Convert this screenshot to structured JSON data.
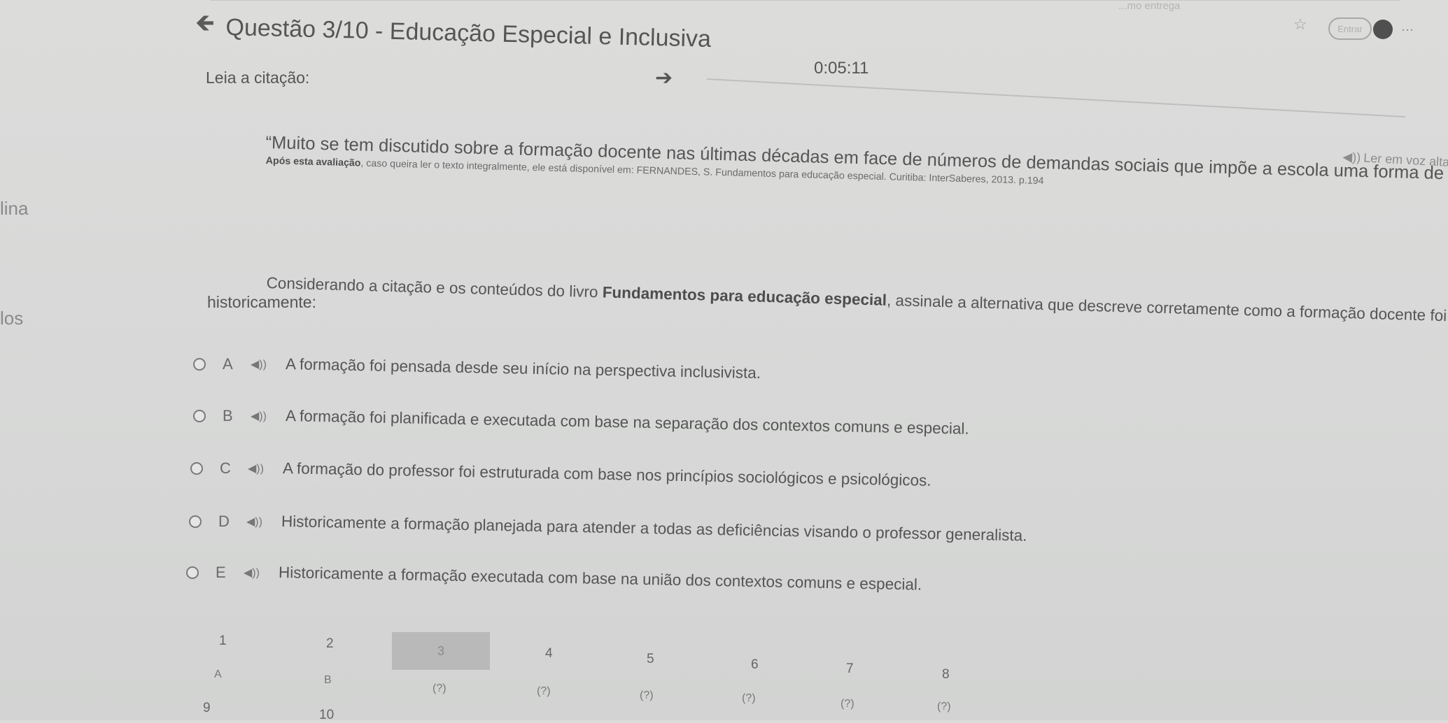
{
  "header": {
    "title": "Questão 3/10 - Educação Especial e Inclusiva",
    "timer": "0:05:11",
    "back_icon": "arrow-left-icon",
    "forward_icon": "arrow-right-icon",
    "top_right_faint": "...mo entrega",
    "top_right_pill": "Entrar"
  },
  "sidebar_fragments": [
    "lina",
    "los"
  ],
  "content": {
    "intro": "Leia a citação:",
    "quote": "“Muito se tem discutido sobre a formação docente nas últimas décadas em face de números de demandas sociais que impõe a escola uma forma de organização”",
    "source_prefix": "Após esta avaliação",
    "source_rest": ", caso queira ler o texto integralmente, ele está disponível em: FERNANDES, S. Fundamentos para educação especial. Curitiba: InterSaberes, 2013. p.194",
    "listen_label": "Ler em voz alta",
    "stem_start": "Considerando a citação e os conteúdos do livro ",
    "stem_book": "Fundamentos para educação especial",
    "stem_end": ", assinale a alternativa que descreve corretamente como a formação docente foi construída",
    "stem_continuation": "historicamente:"
  },
  "options": [
    {
      "letter": "A",
      "text": "A formação foi pensada desde seu início na perspectiva inclusivista."
    },
    {
      "letter": "B",
      "text": "A formação foi planificada e executada com base na separação dos contextos comuns e especial."
    },
    {
      "letter": "C",
      "text": "A formação do professor foi estruturada com base nos princípios sociológicos e psicológicos."
    },
    {
      "letter": "D",
      "text": "Historicamente a formação planejada para atender a todas as deficiências visando o professor generalista."
    },
    {
      "letter": "E",
      "text": "Historicamente a formação executada com base na união dos contextos comuns e especial."
    }
  ],
  "question_nav": {
    "numbers": [
      "1",
      "2",
      "3",
      "4",
      "5",
      "6",
      "7",
      "8",
      "9",
      "10"
    ],
    "answers": [
      "A",
      "B",
      "(?)",
      "(?)",
      "(?)",
      "(?)",
      "(?)",
      "(?)"
    ],
    "active": "3"
  },
  "colors": {
    "background": "#d8d9d8",
    "text": "#555555",
    "active_tab": "#b9b9b9"
  }
}
